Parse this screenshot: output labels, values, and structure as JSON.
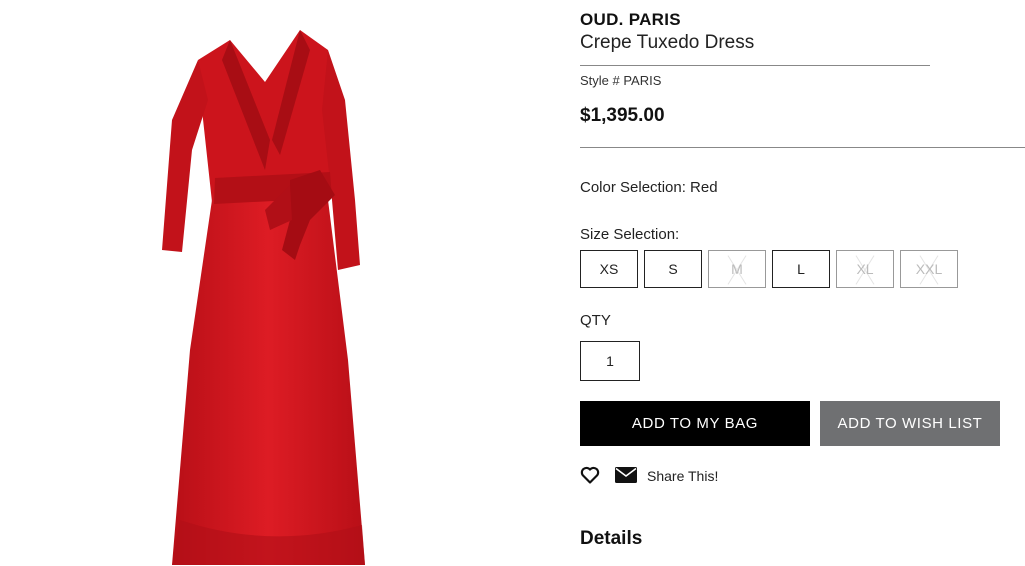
{
  "product": {
    "brand": "OUD. PARIS",
    "name": "Crepe Tuxedo Dress",
    "style": "Style # PARIS",
    "price": "$1,395.00",
    "image_icon": "red-dress-image"
  },
  "color_selection": "Color Selection: Red",
  "size_selection": {
    "label": "Size Selection:",
    "sizes": [
      {
        "label": "XS",
        "available": true
      },
      {
        "label": "S",
        "available": true
      },
      {
        "label": "M",
        "available": false
      },
      {
        "label": "L",
        "available": true
      },
      {
        "label": "XL",
        "available": false
      },
      {
        "label": "XXL",
        "available": false
      }
    ]
  },
  "qty": {
    "label": "QTY",
    "value": "1"
  },
  "actions": {
    "add_to_bag": "ADD TO MY BAG",
    "add_to_wishlist": "ADD TO WISH LIST",
    "share": "Share This!",
    "heart_icon": "heart-icon",
    "mail_icon": "envelope-icon"
  },
  "details_heading": "Details",
  "colors": {
    "dress": "#d2161e",
    "bag_button": "#000000",
    "wish_button": "#6f7072"
  }
}
